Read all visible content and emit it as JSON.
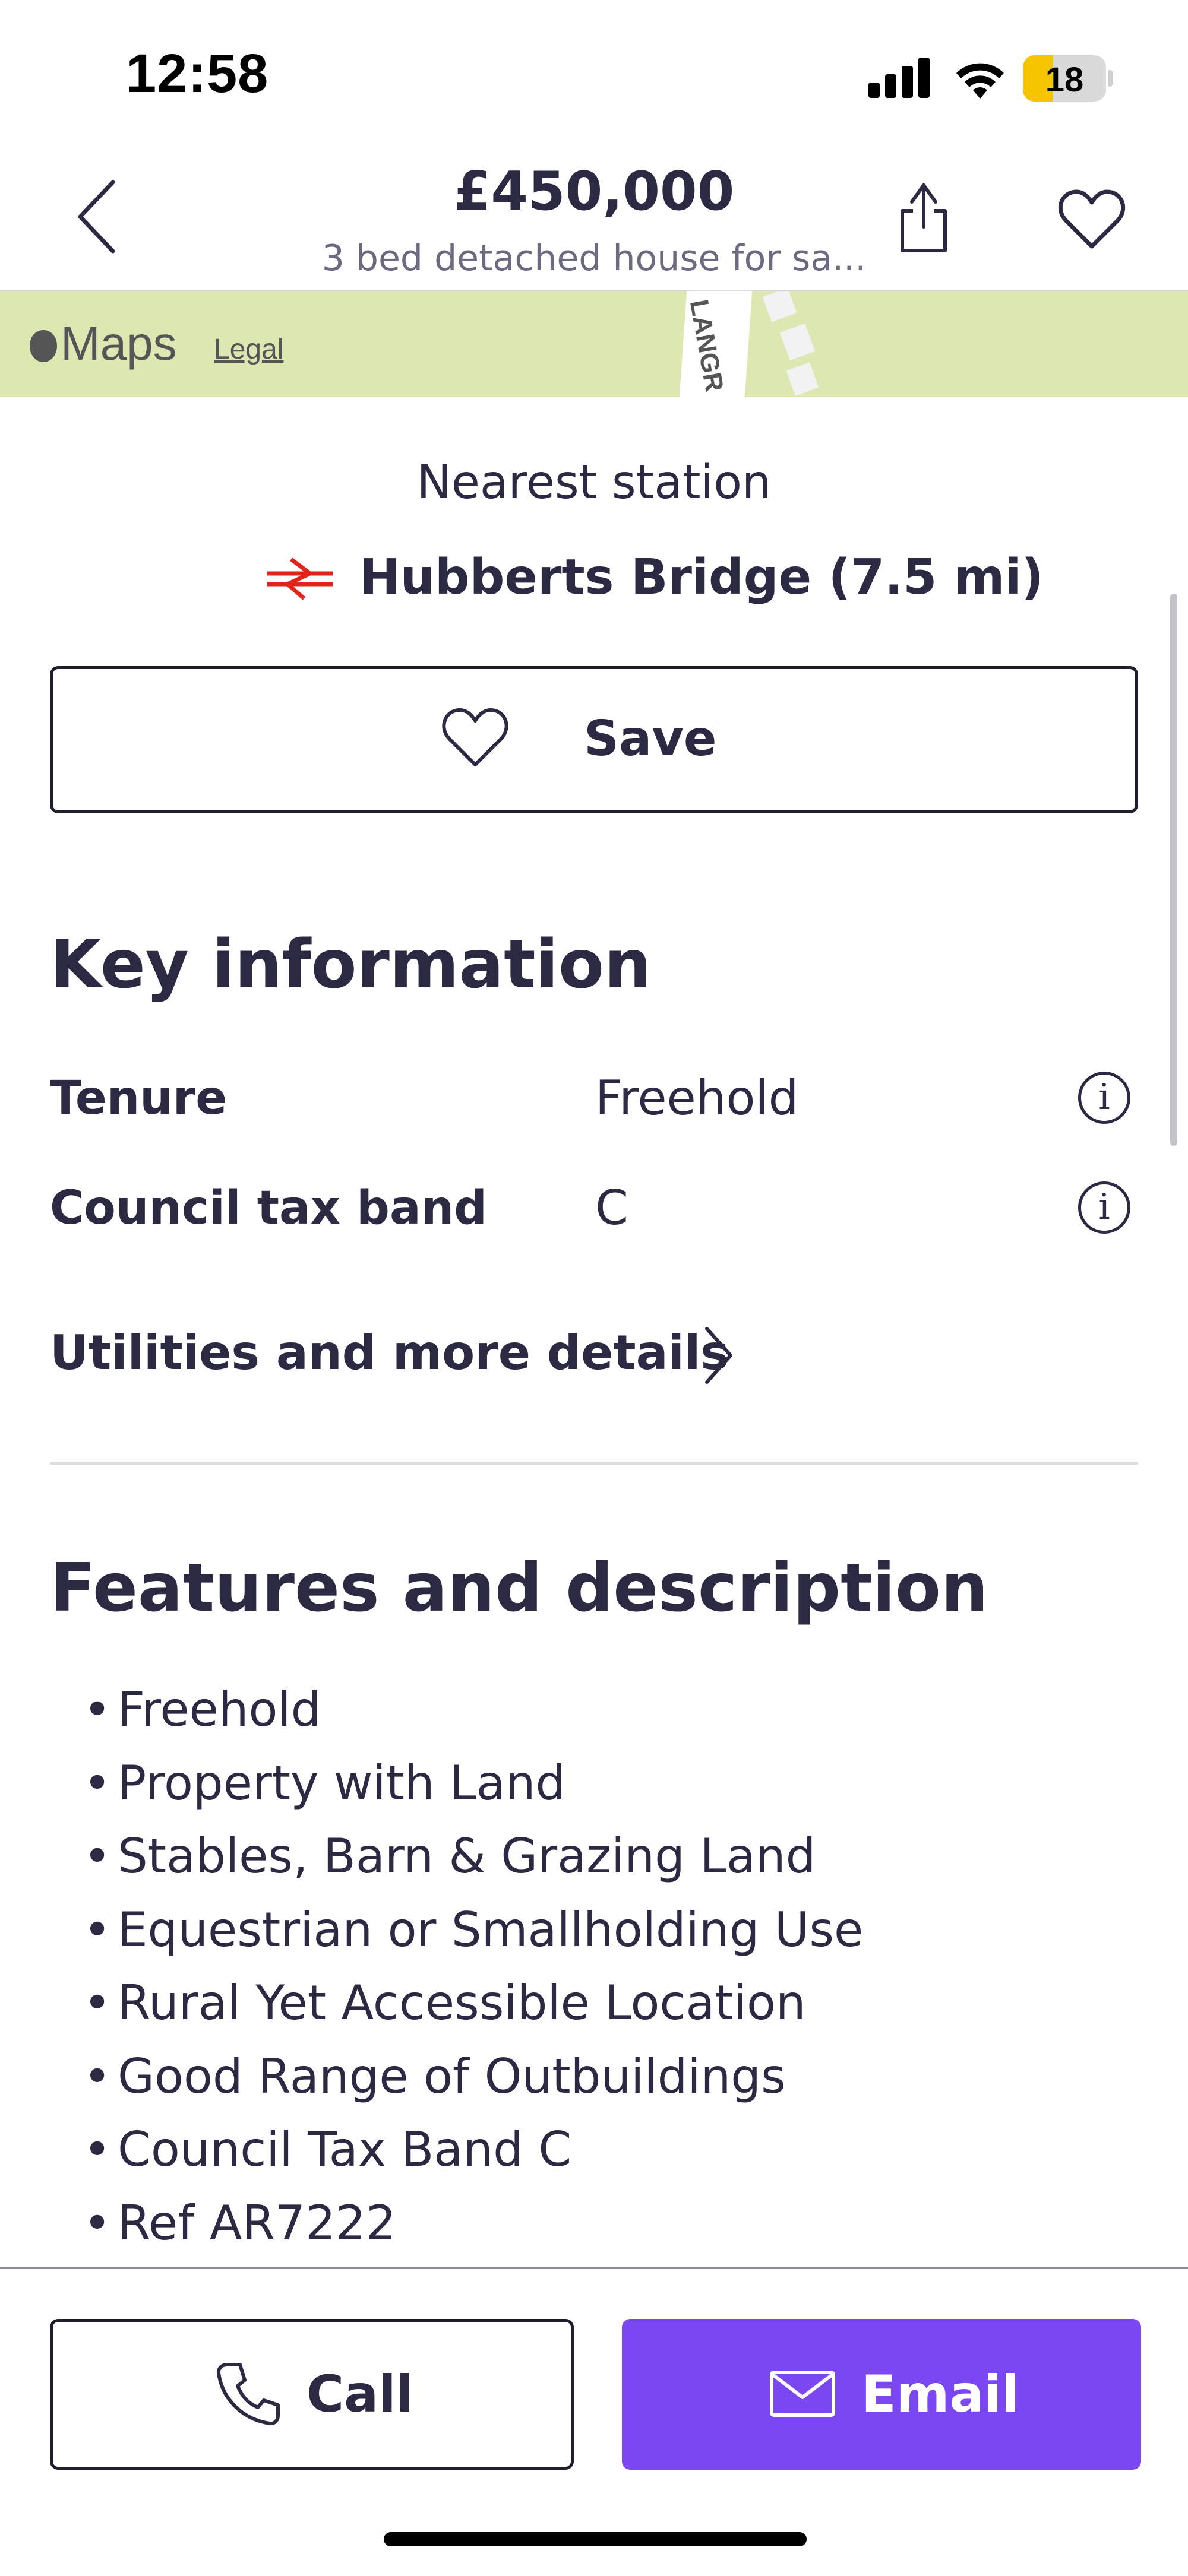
{
  "status_bar": {
    "time": "12:58",
    "battery_level": "18"
  },
  "header": {
    "price": "£450,000",
    "subtitle": "3 bed detached house for sa..."
  },
  "map": {
    "provider_label": "Maps",
    "legal_label": "Legal",
    "road_label": "LANGR"
  },
  "station": {
    "title": "Nearest station",
    "name": "Hubberts Bridge (7.5 mi)"
  },
  "save_button": {
    "label": "Save"
  },
  "key_info": {
    "title": "Key information",
    "rows": [
      {
        "label": "Tenure",
        "value": "Freehold"
      },
      {
        "label": "Council tax band",
        "value": "C"
      }
    ],
    "utilities_label": "Utilities and more details"
  },
  "features": {
    "title": "Features and description",
    "items": [
      "Freehold",
      "Property with Land",
      "Stables, Barn & Grazing Land",
      "Equestrian or Smallholding Use",
      "Rural Yet Accessible Location",
      "Good Range of Outbuildings",
      "Council Tax Band C",
      "Ref AR7222"
    ]
  },
  "actions": {
    "call_label": "Call",
    "email_label": "Email"
  },
  "colors": {
    "accent": "#7b47f2",
    "text": "#2b2a42",
    "map_background": "#dde7b1",
    "rail_red": "#e2231a"
  }
}
